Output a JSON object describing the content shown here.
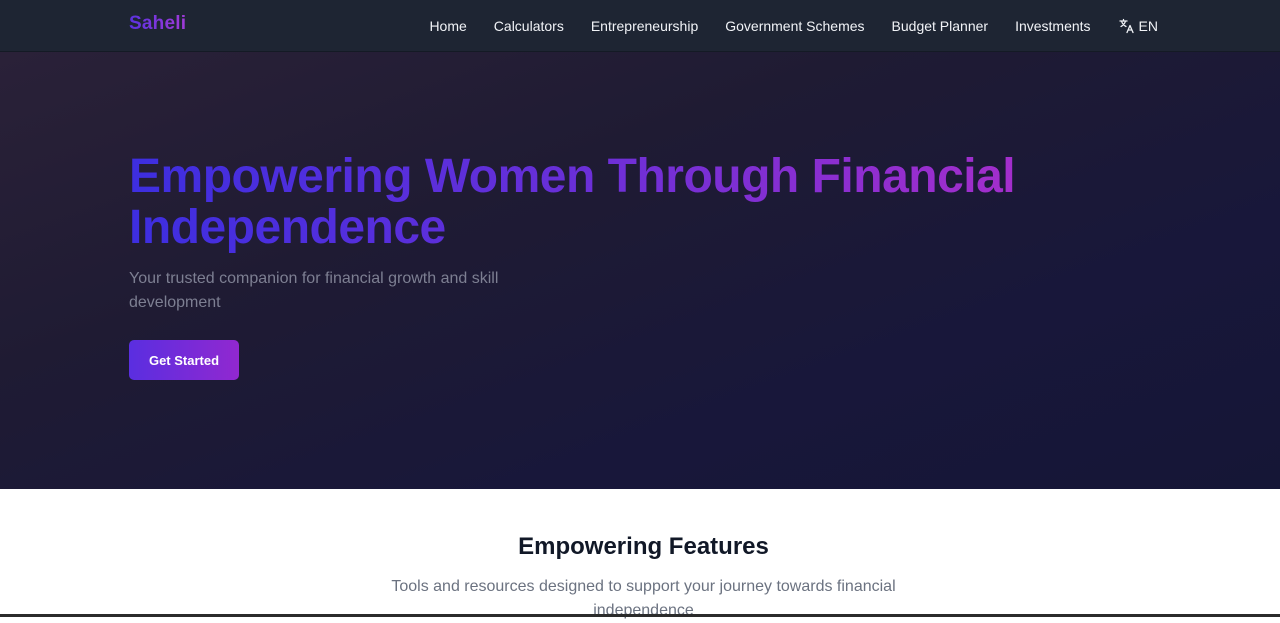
{
  "brand": {
    "name": "Saheli"
  },
  "nav": {
    "items": [
      {
        "label": "Home"
      },
      {
        "label": "Calculators"
      },
      {
        "label": "Entrepreneurship"
      },
      {
        "label": "Government Schemes"
      },
      {
        "label": "Budget Planner"
      },
      {
        "label": "Investments"
      }
    ],
    "language": {
      "label": "EN",
      "icon": "translate-icon"
    }
  },
  "hero": {
    "title": "Empowering Women Through Financial Independence",
    "subtitle": "Your trusted companion for financial growth and skill development",
    "cta_label": "Get Started"
  },
  "features": {
    "title": "Empowering Features",
    "subtitle": "Tools and resources designed to support your journey towards financial independence"
  },
  "colors": {
    "navbar_bg": "#1e2533",
    "hero_bg": "#1f1b33",
    "accent_start": "#3d2ee0",
    "accent_end": "#b22ec8",
    "button_start": "#5a2ee0",
    "button_end": "#9128d0"
  }
}
